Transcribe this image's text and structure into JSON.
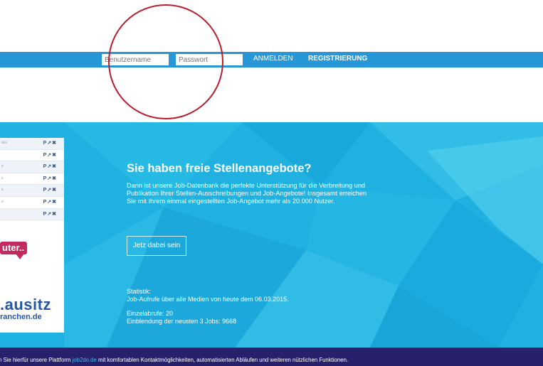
{
  "header": {
    "username_placeholder": "Benutzername",
    "password_placeholder": "Passwort",
    "login_label": "ANMELDEN",
    "register_label": "REGISTRIERUNG"
  },
  "sidebar": {
    "rows": [
      {
        "text": "küs",
        "actions": "P↗✖"
      },
      {
        "text": "",
        "actions": "P↗✖"
      },
      {
        "text": "s",
        "actions": "P↗✖"
      },
      {
        "text": "s",
        "actions": "P↗✖"
      },
      {
        "text": "s",
        "actions": "P↗✖"
      },
      {
        "text": "s",
        "actions": "P↗✖"
      },
      {
        "text": "",
        "actions": "P↗✖"
      }
    ],
    "logo1_text": "uter..",
    "logo2_big": ".ausitz",
    "logo2_small": "ranchen.de"
  },
  "hero": {
    "title": "Sie haben freie Stellenangebote?",
    "description": "Dann ist unsere Job-Datenbank die perfekte Unterstützung für die Verbreitung und Publikation Ihrer Stellen-Ausschreibungen und Job-Angebote! Insgesamt erreichen Sie mit Ihrem einmal eingestellten Job-Angebot mehr als 20.000 Nutzer.",
    "cta_label": "Jetz dabei sein",
    "stats_heading": "Statistik:",
    "stats_line1": "Job-Aufrufe über alle Medien von heute dem 06.03.2015.",
    "stats_line2": "Einzelabrufe: 20",
    "stats_line3": "Einblendung der neusten 3 Jobs: 9668"
  },
  "footer": {
    "text_before": "n Sie hierfür unsere Plattform ",
    "link": "job2do.de",
    "text_after": " mit komfortablen Kontaktmöglichkeiten, automatisierten Abläufen und weiteren nützlichen Funktionen."
  },
  "colors": {
    "topbar": "#2797d8",
    "hero": "#1fb1e0",
    "footer": "#27206b",
    "annotation_circle": "#b81c2d"
  }
}
